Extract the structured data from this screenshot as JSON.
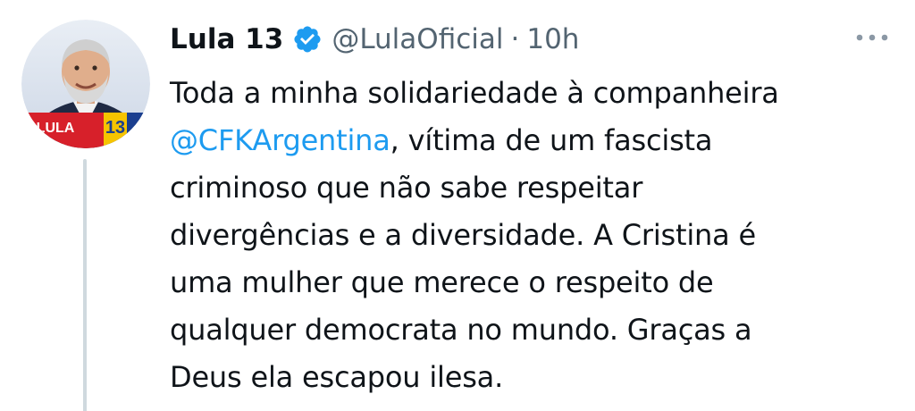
{
  "author": {
    "display_name": "Lula 13",
    "handle": "@LulaOficial",
    "separator": "·",
    "timestamp": "10h",
    "verified": true,
    "avatar_badge": "LULA 13"
  },
  "tweet": {
    "lines": [
      {
        "pre": "Toda a minha solidariedade à companheira",
        "mention": "",
        "post": ""
      },
      {
        "pre": "",
        "mention": "@CFKArgentina",
        "post": ", vítima de um fascista"
      },
      {
        "pre": "criminoso que não sabe respeitar",
        "mention": "",
        "post": ""
      },
      {
        "pre": "divergências e a diversidade. A Cristina é",
        "mention": "",
        "post": ""
      },
      {
        "pre": "uma mulher que merece o respeito de",
        "mention": "",
        "post": ""
      },
      {
        "pre": "qualquer democrata no mundo. Graças a",
        "mention": "",
        "post": ""
      },
      {
        "pre": "Deus ela escapou ilesa.",
        "mention": "",
        "post": ""
      }
    ]
  },
  "icons": {
    "verified": "verified-badge-icon",
    "more": "more-options-icon"
  },
  "colors": {
    "text": "#0f1419",
    "secondary": "#536471",
    "link": "#1d9bf0",
    "thread_line": "#cfd9de",
    "badge_red": "#d7202a",
    "badge_yellow": "#f6c400",
    "badge_blue": "#1b3f8f"
  }
}
